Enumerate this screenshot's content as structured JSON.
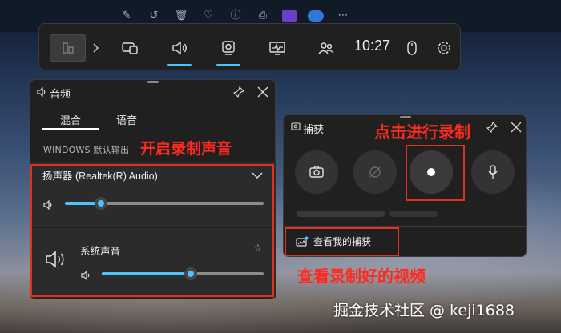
{
  "top_icons": [
    "image-edit-icon",
    "history-icon",
    "trash-icon",
    "heart-icon",
    "info-icon",
    "print-icon",
    "app-tile-icon",
    "cloud-icon",
    "more-icon"
  ],
  "gamebar": {
    "time": "10:27",
    "widgets": [
      "widget-picker-icon",
      "volume-icon",
      "capture-icon",
      "performance-icon",
      "social-icon"
    ],
    "accent": "#4cc2ff"
  },
  "audio": {
    "title": "音频",
    "tabs": [
      {
        "label": "混合",
        "active": true
      },
      {
        "label": "语音",
        "active": false
      }
    ],
    "output_label": "WINDOWS 默认输出",
    "device": "扬声器 (Realtek(R) Audio)",
    "device_volume": 0.18,
    "app_name": "系统声音",
    "app_volume": 0.55
  },
  "capture": {
    "title": "捕获",
    "view_link": "查看我的捕获"
  },
  "annotations": {
    "enable_audio": "开启录制声音",
    "click_record": "点击进行录制",
    "view_video": "查看录制好的视频"
  },
  "annotation_color": "#ff2a1f",
  "watermark": "掘金技术社区 @ keji1688"
}
